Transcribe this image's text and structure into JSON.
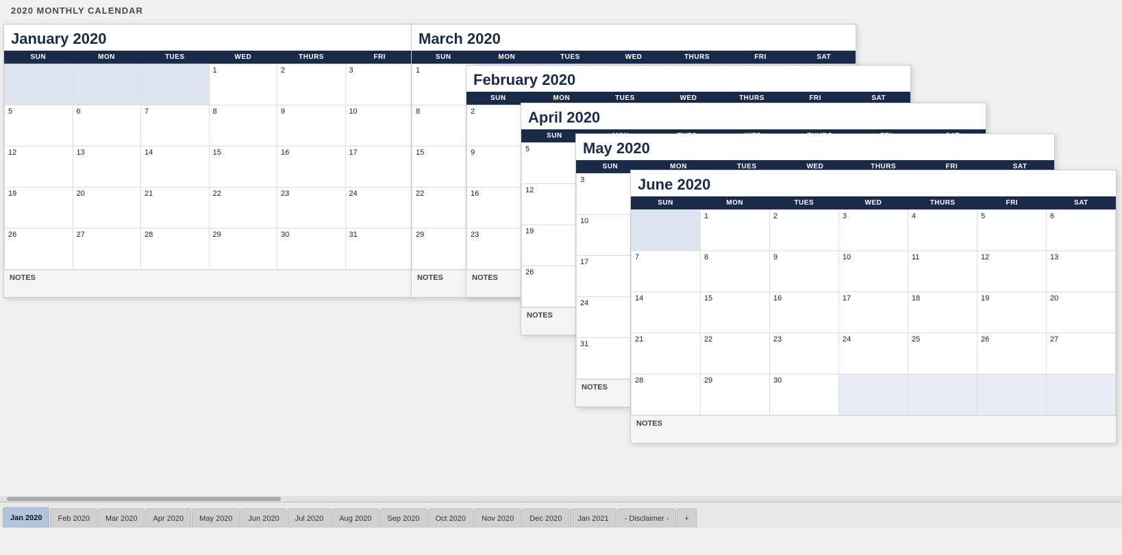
{
  "page": {
    "title": "2020 MONTHLY CALENDAR"
  },
  "january": {
    "title": "January 2020",
    "headers": [
      "SUN",
      "MON",
      "TUES",
      "WED",
      "THURS",
      "FRI"
    ],
    "rows": [
      [
        {
          "num": "",
          "empty": true
        },
        {
          "num": "",
          "empty": true
        },
        {
          "num": "",
          "empty": true
        },
        {
          "num": "1"
        },
        {
          "num": "2"
        },
        {
          "num": "3"
        }
      ],
      [
        {
          "num": "5"
        },
        {
          "num": "6"
        },
        {
          "num": "7"
        },
        {
          "num": "8"
        },
        {
          "num": "9"
        },
        {
          "num": "10"
        }
      ],
      [
        {
          "num": "12"
        },
        {
          "num": "13"
        },
        {
          "num": "14"
        },
        {
          "num": "15"
        },
        {
          "num": "16"
        },
        {
          "num": "17"
        }
      ],
      [
        {
          "num": "19"
        },
        {
          "num": "20"
        },
        {
          "num": "21"
        },
        {
          "num": "22"
        },
        {
          "num": "23"
        },
        {
          "num": "24"
        }
      ],
      [
        {
          "num": "26"
        },
        {
          "num": "27"
        },
        {
          "num": "28"
        },
        {
          "num": "29"
        },
        {
          "num": "30"
        },
        {
          "num": "31"
        }
      ]
    ],
    "notes": "NOTES"
  },
  "march": {
    "title": "March 2020",
    "headers": [
      "SUN",
      "MON",
      "TUES",
      "WED",
      "THURS",
      "FRI",
      "SAT"
    ],
    "rows": [
      [
        {
          "num": "1"
        },
        {
          "num": "",
          "empty": true
        },
        {
          "num": "",
          "empty": true
        },
        {
          "num": "",
          "empty": true
        },
        {
          "num": "",
          "empty": true
        },
        {
          "num": "",
          "empty": true
        },
        {
          "num": "",
          "empty": true
        }
      ],
      [
        {
          "num": "8"
        },
        {
          "num": "",
          "empty": false
        },
        {
          "num": "",
          "empty": false
        },
        {
          "num": "",
          "empty": false
        },
        {
          "num": "",
          "empty": false
        },
        {
          "num": "",
          "empty": false
        },
        {
          "num": "",
          "empty": false
        }
      ],
      [
        {
          "num": "15"
        },
        {
          "num": ""
        },
        {
          "num": ""
        },
        {
          "num": ""
        },
        {
          "num": ""
        },
        {
          "num": ""
        },
        {
          "num": ""
        }
      ],
      [
        {
          "num": "22"
        },
        {
          "num": ""
        },
        {
          "num": ""
        },
        {
          "num": ""
        },
        {
          "num": ""
        },
        {
          "num": ""
        },
        {
          "num": ""
        }
      ],
      [
        {
          "num": "29"
        },
        {
          "num": ""
        },
        {
          "num": ""
        },
        {
          "num": ""
        },
        {
          "num": ""
        },
        {
          "num": ""
        },
        {
          "num": ""
        }
      ]
    ],
    "notes": "NOTES"
  },
  "february": {
    "title": "February 2020",
    "headers": [
      "SUN",
      "MON",
      "TUES",
      "WED",
      "THURS",
      "FRI",
      "SAT"
    ],
    "rows": [
      [
        {
          "num": "2"
        },
        {
          "num": "",
          "empty": true
        },
        {
          "num": "",
          "empty": true
        },
        {
          "num": "",
          "empty": true
        },
        {
          "num": "",
          "empty": true
        },
        {
          "num": "",
          "empty": true
        },
        {
          "num": "",
          "empty": true
        }
      ],
      [
        {
          "num": "9"
        },
        {
          "num": ""
        },
        {
          "num": ""
        },
        {
          "num": ""
        },
        {
          "num": ""
        },
        {
          "num": ""
        },
        {
          "num": ""
        }
      ],
      [
        {
          "num": "16"
        },
        {
          "num": ""
        },
        {
          "num": ""
        },
        {
          "num": ""
        },
        {
          "num": ""
        },
        {
          "num": ""
        },
        {
          "num": ""
        }
      ],
      [
        {
          "num": "23"
        },
        {
          "num": ""
        },
        {
          "num": ""
        },
        {
          "num": ""
        },
        {
          "num": ""
        },
        {
          "num": ""
        },
        {
          "num": ""
        }
      ]
    ],
    "notes": "NOTES"
  },
  "april": {
    "title": "April 2020",
    "headers": [
      "SUN",
      "MON",
      "TUES",
      "WED",
      "THURS",
      "FRI",
      "SAT"
    ],
    "rows": [
      [
        {
          "num": "5"
        },
        {
          "num": "",
          "empty": true
        },
        {
          "num": "",
          "empty": true
        },
        {
          "num": "",
          "empty": true
        },
        {
          "num": "",
          "empty": true
        },
        {
          "num": "",
          "empty": true
        },
        {
          "num": "",
          "empty": true
        }
      ],
      [
        {
          "num": "12"
        },
        {
          "num": ""
        },
        {
          "num": ""
        },
        {
          "num": ""
        },
        {
          "num": ""
        },
        {
          "num": ""
        },
        {
          "num": ""
        }
      ],
      [
        {
          "num": "19"
        },
        {
          "num": ""
        },
        {
          "num": ""
        },
        {
          "num": ""
        },
        {
          "num": ""
        },
        {
          "num": ""
        },
        {
          "num": ""
        }
      ],
      [
        {
          "num": "26"
        },
        {
          "num": ""
        },
        {
          "num": ""
        },
        {
          "num": ""
        },
        {
          "num": ""
        },
        {
          "num": ""
        },
        {
          "num": ""
        }
      ]
    ],
    "notes": "NOTES"
  },
  "may": {
    "title": "May 2020",
    "headers": [
      "SUN",
      "MON",
      "TUES",
      "WED",
      "THURS",
      "FRI",
      "SAT"
    ],
    "rows": [
      [
        {
          "num": "3"
        },
        {
          "num": "",
          "empty": true
        },
        {
          "num": "",
          "empty": true
        },
        {
          "num": "",
          "empty": true
        },
        {
          "num": "",
          "empty": true
        },
        {
          "num": "",
          "empty": true
        },
        {
          "num": "",
          "empty": true
        }
      ],
      [
        {
          "num": "10"
        },
        {
          "num": ""
        },
        {
          "num": ""
        },
        {
          "num": ""
        },
        {
          "num": ""
        },
        {
          "num": ""
        },
        {
          "num": ""
        }
      ],
      [
        {
          "num": "17"
        },
        {
          "num": ""
        },
        {
          "num": ""
        },
        {
          "num": ""
        },
        {
          "num": ""
        },
        {
          "num": ""
        },
        {
          "num": ""
        }
      ],
      [
        {
          "num": "24"
        },
        {
          "num": ""
        },
        {
          "num": ""
        },
        {
          "num": ""
        },
        {
          "num": ""
        },
        {
          "num": ""
        },
        {
          "num": ""
        }
      ],
      [
        {
          "num": "31"
        },
        {
          "num": ""
        },
        {
          "num": ""
        },
        {
          "num": ""
        },
        {
          "num": ""
        },
        {
          "num": ""
        },
        {
          "num": ""
        }
      ]
    ],
    "notes": "NOTES"
  },
  "june": {
    "title": "June 2020",
    "headers": [
      "SUN",
      "MON",
      "TUES",
      "WED",
      "THURS",
      "FRI",
      "SAT"
    ],
    "rows": [
      [
        {
          "num": "",
          "empty": true
        },
        {
          "num": "1"
        },
        {
          "num": "2"
        },
        {
          "num": "3"
        },
        {
          "num": "4"
        },
        {
          "num": "5"
        },
        {
          "num": "6"
        }
      ],
      [
        {
          "num": "7"
        },
        {
          "num": "8"
        },
        {
          "num": "9"
        },
        {
          "num": "10"
        },
        {
          "num": "11"
        },
        {
          "num": "12"
        },
        {
          "num": "13"
        }
      ],
      [
        {
          "num": "14"
        },
        {
          "num": "15"
        },
        {
          "num": "16"
        },
        {
          "num": "17"
        },
        {
          "num": "18"
        },
        {
          "num": "19"
        },
        {
          "num": "20"
        }
      ],
      [
        {
          "num": "21"
        },
        {
          "num": "22"
        },
        {
          "num": "23"
        },
        {
          "num": "24"
        },
        {
          "num": "25"
        },
        {
          "num": "26"
        },
        {
          "num": "27"
        }
      ],
      [
        {
          "num": "28"
        },
        {
          "num": "29"
        },
        {
          "num": "30"
        },
        {
          "num": "",
          "empty": true
        },
        {
          "num": "",
          "empty": true
        },
        {
          "num": "",
          "empty": true
        },
        {
          "num": "",
          "empty": true
        }
      ]
    ],
    "notes": "NOTES"
  },
  "tabs": [
    "Jan 2020",
    "Feb 2020",
    "Mar 2020",
    "Apr 2020",
    "May 2020",
    "Jun 2020",
    "Jul 2020",
    "Aug 2020",
    "Sep 2020",
    "Oct 2020",
    "Nov 2020",
    "Dec 2020",
    "Jan 2021",
    "- Disclaimer -"
  ],
  "active_tab": "Jan 2020"
}
